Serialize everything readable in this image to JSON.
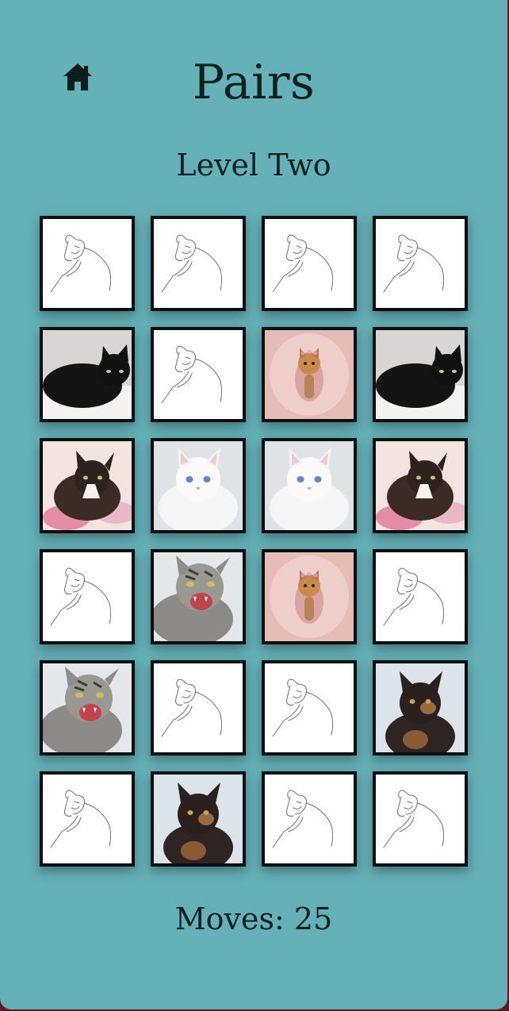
{
  "game": {
    "title": "Pairs",
    "level": "Level Two",
    "moves_label": "Moves:",
    "moves": 25
  },
  "icons": {
    "home": "home-icon",
    "card_back": "cat-outline-icon"
  },
  "colors": {
    "background": "#64b1b8",
    "card_border": "#0c0f0e",
    "card_back": "#ffffff",
    "text": "#10201e"
  },
  "board": {
    "columns": 4,
    "rows": 6,
    "cards": [
      {
        "state": "hidden"
      },
      {
        "state": "hidden"
      },
      {
        "state": "hidden"
      },
      {
        "state": "hidden"
      },
      {
        "state": "revealed",
        "cat": "black-cat"
      },
      {
        "state": "hidden"
      },
      {
        "state": "revealed",
        "cat": "ginger-kitten-pink"
      },
      {
        "state": "revealed",
        "cat": "black-cat"
      },
      {
        "state": "revealed",
        "cat": "black-white-cat"
      },
      {
        "state": "revealed",
        "cat": "white-cat"
      },
      {
        "state": "revealed",
        "cat": "white-cat"
      },
      {
        "state": "revealed",
        "cat": "black-white-cat"
      },
      {
        "state": "hidden"
      },
      {
        "state": "revealed",
        "cat": "tabby-hissing"
      },
      {
        "state": "revealed",
        "cat": "ginger-kitten-pink"
      },
      {
        "state": "hidden"
      },
      {
        "state": "revealed",
        "cat": "tabby-hissing"
      },
      {
        "state": "hidden"
      },
      {
        "state": "hidden"
      },
      {
        "state": "revealed",
        "cat": "tortoiseshell-cat"
      },
      {
        "state": "hidden"
      },
      {
        "state": "revealed",
        "cat": "tortoiseshell-cat"
      },
      {
        "state": "hidden"
      },
      {
        "state": "hidden"
      }
    ]
  }
}
